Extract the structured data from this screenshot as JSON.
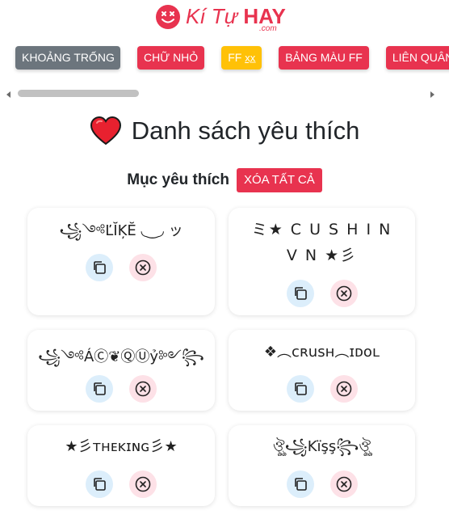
{
  "logo": {
    "text_main": "Kí Tự",
    "text_bold": "HAY",
    "text_sub": ".com"
  },
  "nav": [
    {
      "label": "KHOẢNG TRỐNG",
      "style": "gray"
    },
    {
      "label": "CHỮ NHỎ",
      "style": "red"
    },
    {
      "label": "FF",
      "suffix": "xx̲",
      "style": "yellow"
    },
    {
      "label": "BẢNG MÀU FF",
      "style": "red"
    },
    {
      "label": "LIÊN QUÂN",
      "style": "red"
    }
  ],
  "page_title": "Danh sách yêu thích",
  "favorites_heading": "Mục yêu thích",
  "clear_all_label": "XÓA TẤT CẢ",
  "cards": [
    {
      "text": "꧁༺ĽĬĶĔ ◟‿◞ ッ"
    },
    {
      "text": "ミ★ C U S H I N V N ★彡"
    },
    {
      "text": "꧁༺ÁⒸ❦ⓆⓊỷ༻꧂"
    },
    {
      "text": "❖︵cʀusʜ︵ɪᴅᴏʟ"
    },
    {
      "text": "★彡ᴛʜᴇᴋɪɴɢ彡★"
    },
    {
      "text": "ঔৣ꧁Kïşş꧂ঔৣ"
    }
  ],
  "colors": {
    "brand": "#e8334f",
    "gray": "#6c757d",
    "yellow": "#ffc107"
  },
  "icons": {
    "copy": "copy-icon",
    "remove": "remove-icon",
    "heart": "heart-icon"
  }
}
